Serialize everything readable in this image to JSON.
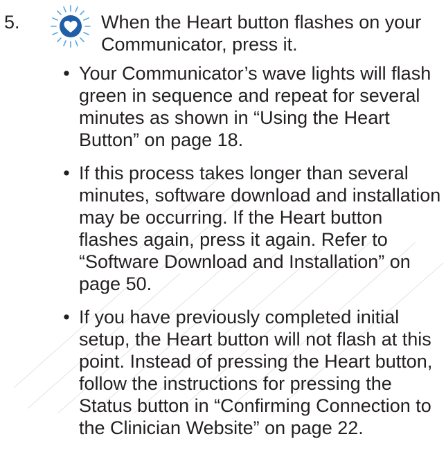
{
  "step": {
    "number": "5.",
    "icon": "heart-button-flashing-icon",
    "icon_color": "#1f5fa8",
    "text": "When the Heart button flashes on your Communicator, press it."
  },
  "bullets": [
    {
      "marker": "•",
      "text": "Your Communicator’s wave lights will flash green in sequence and repeat for several minutes as shown in “Using the Heart Button” on page 18."
    },
    {
      "marker": "•",
      "text": "If this process takes longer than several minutes, software download and installation may be occurring. If the Heart button flashes again, press it again. Refer to “Software Download and Installation” on page 50."
    },
    {
      "marker": "•",
      "text": "If you have previously completed initial setup, the Heart button will not flash at this point. Instead of pressing the Heart button, follow the instructions for pressing the Status button in “Confirming Connection to the Clinician Website” on page 22."
    }
  ],
  "colors": {
    "text": "#231f20",
    "background": "#ffffff",
    "watermark": "#c9c9c9"
  }
}
